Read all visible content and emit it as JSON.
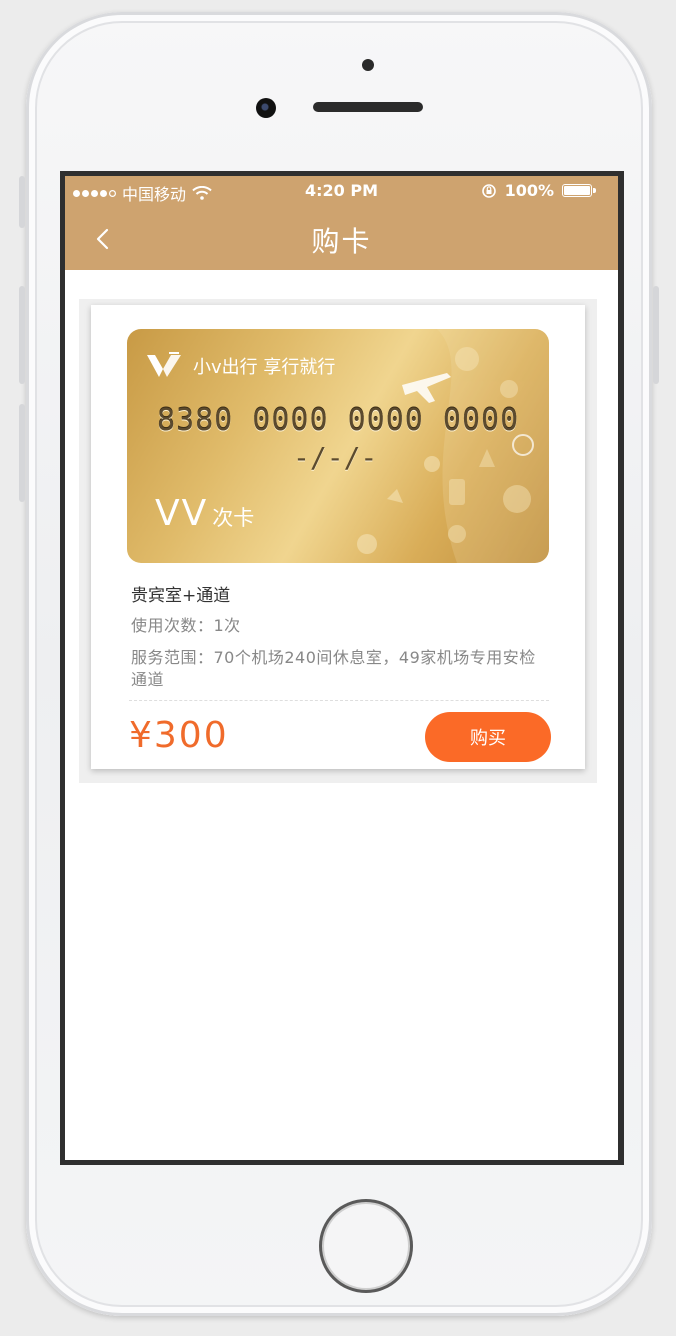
{
  "status_bar": {
    "carrier": "中国移动",
    "time": "4:20 PM",
    "battery": "100%",
    "battery_level": 1.0
  },
  "nav": {
    "title": "购卡",
    "back_icon": "chevron-left-icon"
  },
  "card": {
    "brand_text": "小v出行 享行就行",
    "number": "8380 0000 0000 0000",
    "date": "-/-/-",
    "name": "VV",
    "type": "次卡",
    "title": "贵宾室+通道",
    "usage": "使用次数：1次",
    "service": "服务范围：70个机场240间休息室，49家机场专用安检通道",
    "price": "¥300",
    "buy_label": "购买"
  },
  "colors": {
    "header": "#cea36f",
    "accent": "#fb6a27",
    "price": "#f06b2b"
  }
}
